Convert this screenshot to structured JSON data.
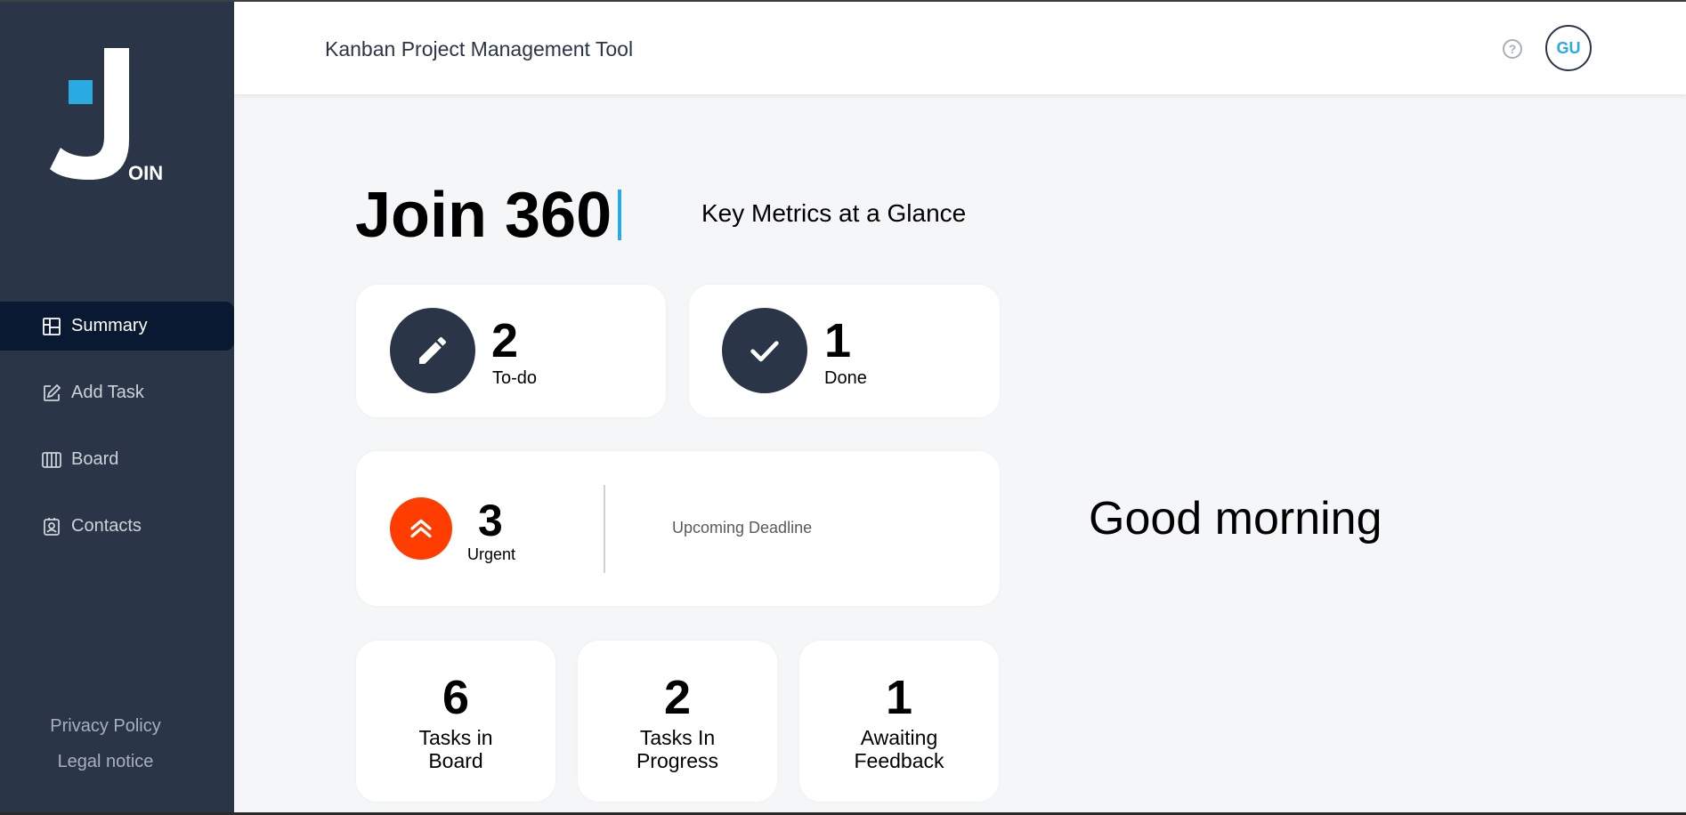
{
  "app": {
    "logo_text": "OIN",
    "header_title": "Kanban Project Management Tool",
    "help_symbol": "?",
    "avatar_initials": "GU"
  },
  "sidebar": {
    "items": [
      {
        "label": "Summary",
        "icon": "summary-icon",
        "active": true
      },
      {
        "label": "Add Task",
        "icon": "add-task-icon",
        "active": false
      },
      {
        "label": "Board",
        "icon": "board-icon",
        "active": false
      },
      {
        "label": "Contacts",
        "icon": "contacts-icon",
        "active": false
      }
    ],
    "footer": {
      "privacy": "Privacy Policy",
      "legal": "Legal notice"
    }
  },
  "summary": {
    "title": "Join 360",
    "subtitle": "Key Metrics at a Glance",
    "todo": {
      "count": "2",
      "label": "To-do",
      "icon": "pencil-icon"
    },
    "done": {
      "count": "1",
      "label": "Done",
      "icon": "check-icon"
    },
    "urgent": {
      "count": "3",
      "label": "Urgent",
      "icon": "double-chevron-up-icon",
      "deadline_label": "Upcoming Deadline"
    },
    "tasks": [
      {
        "count": "6",
        "line1": "Tasks in",
        "line2": "Board"
      },
      {
        "count": "2",
        "line1": "Tasks In",
        "line2": "Progress"
      },
      {
        "count": "1",
        "line1": "Awaiting",
        "line2": "Feedback"
      }
    ],
    "greeting": "Good morning"
  },
  "colors": {
    "sidebar_bg": "#2a3647",
    "sidebar_active": "#091931",
    "accent_blue": "#29abe2",
    "urgent_orange": "#ff3d00",
    "page_bg": "#f5f6f8"
  }
}
